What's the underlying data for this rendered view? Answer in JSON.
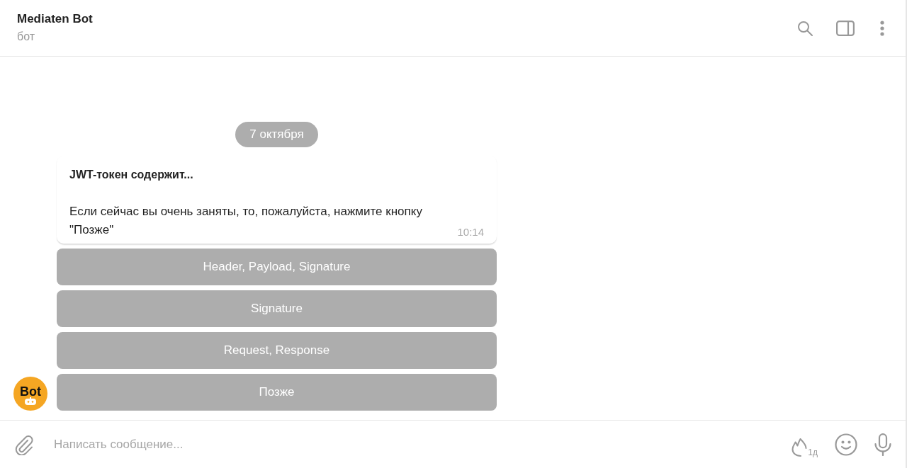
{
  "header": {
    "title": "Mediaten Bot",
    "subtitle": "бот"
  },
  "date_badge": "7 октября",
  "message": {
    "title": "JWT-токен содержит...",
    "text": "Если сейчас вы очень заняты, то, пожалуйста, нажмите кнопку \"Позже\"",
    "time": "10:14"
  },
  "avatar": {
    "label": "Bot"
  },
  "keyboard_buttons": [
    "Header, Payload, Signature",
    "Signature",
    "Request, Response",
    "Позже"
  ],
  "composer": {
    "placeholder": "Написать сообщение...",
    "timer_label": "1д"
  }
}
